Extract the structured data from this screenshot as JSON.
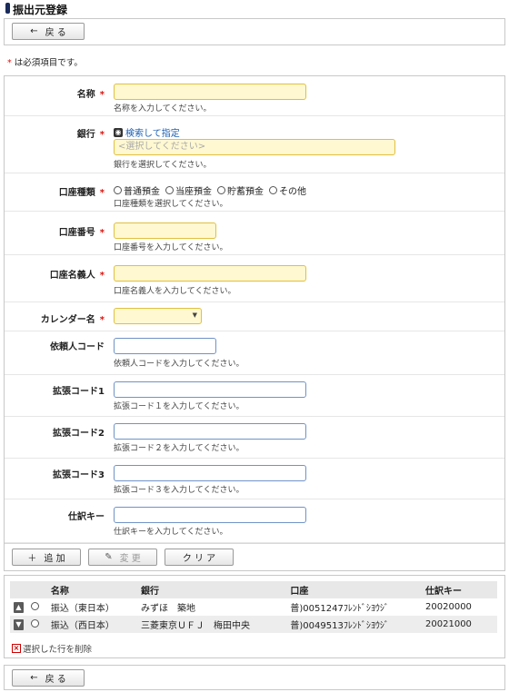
{
  "page_title": "振出元登録",
  "back_label": "戻 る",
  "required_note": "は必須項目です。",
  "required_mark": "*",
  "form": {
    "name": {
      "label": "名称",
      "hint": "名称を入力してください。"
    },
    "bank": {
      "label": "銀行",
      "search_link": "検索して指定",
      "placeholder": "<選択してください>",
      "hint": "銀行を選択してください。"
    },
    "account_type": {
      "label": "口座種類",
      "options": [
        "普通預金",
        "当座預金",
        "貯蓄預金",
        "その他"
      ],
      "hint": "口座種類を選択してください。"
    },
    "account_number": {
      "label": "口座番号",
      "hint": "口座番号を入力してください。"
    },
    "account_holder": {
      "label": "口座名義人",
      "hint": "口座名義人を入力してください。"
    },
    "calendar": {
      "label": "カレンダー名"
    },
    "requester_code": {
      "label": "依頼人コード",
      "hint": "依頼人コードを入力してください。"
    },
    "ext_code1": {
      "label": "拡張コード1",
      "hint": "拡張コード１を入力してください。"
    },
    "ext_code2": {
      "label": "拡張コード2",
      "hint": "拡張コード２を入力してください。"
    },
    "ext_code3": {
      "label": "拡張コード3",
      "hint": "拡張コード３を入力してください。"
    },
    "journal_key": {
      "label": "仕訳キー",
      "hint": "仕訳キーを入力してください。"
    }
  },
  "actions": {
    "add": "追 加",
    "change": "変 更",
    "clear": "ク リ ア"
  },
  "table": {
    "headers": [
      "名称",
      "銀行",
      "口座",
      "仕訳キー"
    ],
    "rows": [
      {
        "name": "振込（東日本）",
        "bank": "みずほ　築地",
        "account": "普)0051247ﾌﾚﾝﾄﾞｼﾖｳｼﾞ",
        "key": "20020000"
      },
      {
        "name": "振込（西日本）",
        "bank": "三菱東京ＵＦＪ　梅田中央",
        "account": "普)0049513ﾌﾚﾝﾄﾞｼﾖｳｼﾞ",
        "key": "20021000"
      }
    ],
    "delete_label": "選択した行を削除"
  },
  "colors": {
    "required": "#d9140e",
    "link": "#1a5fb4",
    "required_field_bg": "#fff8d0"
  },
  "icons": {
    "back": "arrow-left-icon",
    "add": "plus-icon",
    "change": "pencil-icon",
    "search": "magnifier-icon",
    "up": "chevron-up-icon",
    "down": "chevron-down-icon",
    "delete": "x-box-icon"
  }
}
